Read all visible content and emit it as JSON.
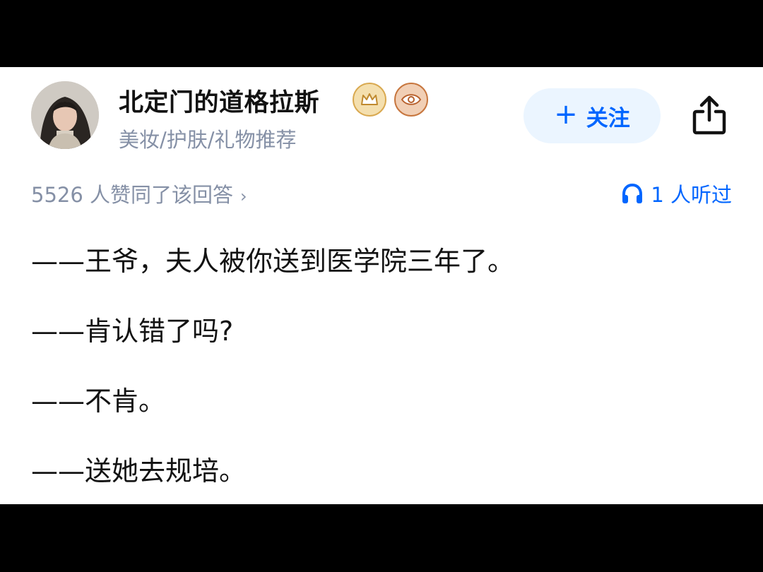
{
  "author": {
    "name": "北定门的道格拉斯",
    "tags": "美妆/护肤/礼物推荐",
    "badges": [
      "crown-badge-icon",
      "eye-badge-icon"
    ]
  },
  "actions": {
    "follow_plus": "+",
    "follow_label": "关注",
    "share_icon": "share-icon"
  },
  "stats": {
    "likes_text": "5526 人赞同了该回答",
    "likes_chevron": "›",
    "listened_text": "1 人听过"
  },
  "content": {
    "lines": [
      "——王爷，夫人被你送到医学院三年了。",
      "——肯认错了吗?",
      "——不肯。",
      "——送她去规培。"
    ]
  },
  "colors": {
    "accent": "#0066ff",
    "follow_bg": "#ebf5ff",
    "secondary_text": "#8590a6",
    "primary_text": "#121212"
  }
}
